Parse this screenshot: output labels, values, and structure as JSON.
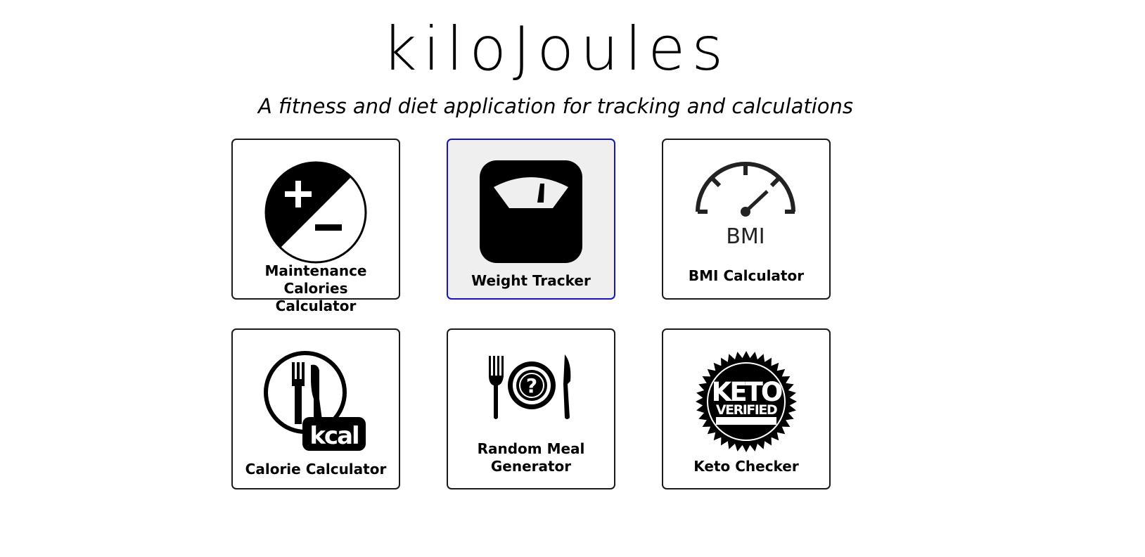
{
  "header": {
    "title": "kiloJoules",
    "subtitle": "A fitness and diet application for tracking and calculations"
  },
  "cards": [
    {
      "label_lines": [
        "Maintenance Calories",
        "Calculator"
      ],
      "icon": "plus-minus-icon",
      "active": false
    },
    {
      "label_lines": [
        "Weight Tracker"
      ],
      "icon": "scale-icon",
      "active": true
    },
    {
      "label_lines": [
        "BMI Calculator"
      ],
      "icon": "gauge-icon",
      "icon_text": "BMI",
      "active": false
    },
    {
      "label_lines": [
        "Calorie Calculator"
      ],
      "icon": "fork-knife-kcal-icon",
      "icon_text": "kcal",
      "active": false
    },
    {
      "label_lines": [
        "Random Meal",
        "Generator"
      ],
      "icon": "plate-question-icon",
      "icon_text": "?",
      "active": false
    },
    {
      "label_lines": [
        "Keto Checker"
      ],
      "icon": "keto-badge-icon",
      "icon_text": [
        "KETO",
        "VERIFIED"
      ],
      "active": false
    }
  ],
  "colors": {
    "card_border": "#1a1a1a",
    "active_border": "#1515b8",
    "active_background": "#efefef"
  }
}
